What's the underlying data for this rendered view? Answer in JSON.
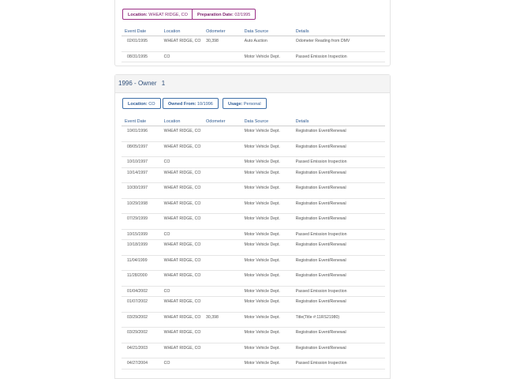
{
  "prev_card": {
    "chips": [
      {
        "label": "Location:",
        "value": "WHEAT RIDGE, CO"
      },
      {
        "label": "Preparation Date:",
        "value": "02/1995"
      }
    ],
    "columns": [
      "Event Date",
      "Location",
      "Odometer",
      "Data Source",
      "Details"
    ],
    "rows": [
      [
        "02/01/1995",
        "WHEAT RIDGE, CO",
        "30,398",
        "Auto Auction",
        "Odometer Reading from DMV"
      ],
      [
        "08/31/1995",
        "CO",
        "",
        "Motor Vehicle Dept.",
        "Passed Emission Inspection"
      ]
    ]
  },
  "owner_card": {
    "year": "1996",
    "dash": "-",
    "owner_label": "Owner",
    "owner_number": "1",
    "chips": [
      {
        "label": "Location:",
        "value": "CO"
      },
      {
        "label": "Owned From:",
        "value": "10/1996"
      },
      {
        "label": "Usage:",
        "value": "Personal"
      }
    ],
    "columns": [
      "Event Date",
      "Location",
      "Odometer",
      "Data Source",
      "Details"
    ],
    "rows": [
      [
        "10/01/1996",
        "WHEAT RIDGE, CO",
        "",
        "Motor Vehicle Dept.",
        "Registration Event/Renewal"
      ],
      [
        "08/05/1997",
        "WHEAT RIDGE, CO",
        "",
        "Motor Vehicle Dept.",
        "Registration Event/Renewal"
      ],
      [
        "10/10/1997",
        "CO",
        "",
        "Motor Vehicle Dept.",
        "Passed Emission Inspection"
      ],
      [
        "10/14/1997",
        "WHEAT RIDGE, CO",
        "",
        "Motor Vehicle Dept.",
        "Registration Event/Renewal"
      ],
      [
        "10/30/1997",
        "WHEAT RIDGE, CO",
        "",
        "Motor Vehicle Dept.",
        "Registration Event/Renewal"
      ],
      [
        "10/29/1998",
        "WHEAT RIDGE, CO",
        "",
        "Motor Vehicle Dept.",
        "Registration Event/Renewal"
      ],
      [
        "07/29/1999",
        "WHEAT RIDGE, CO",
        "",
        "Motor Vehicle Dept.",
        "Registration Event/Renewal"
      ],
      [
        "10/15/1999",
        "CO",
        "",
        "Motor Vehicle Dept.",
        "Passed Emission Inspection"
      ],
      [
        "10/18/1999",
        "WHEAT RIDGE, CO",
        "",
        "Motor Vehicle Dept.",
        "Registration Event/Renewal"
      ],
      [
        "11/04/1999",
        "WHEAT RIDGE, CO",
        "",
        "Motor Vehicle Dept.",
        "Registration Event/Renewal"
      ],
      [
        "11/28/2000",
        "WHEAT RIDGE, CO",
        "",
        "Motor Vehicle Dept.",
        "Registration Event/Renewal"
      ],
      [
        "01/04/2002",
        "CO",
        "",
        "Motor Vehicle Dept.",
        "Passed Emission Inspection"
      ],
      [
        "01/07/2002",
        "WHEAT RIDGE, CO",
        "",
        "Motor Vehicle Dept.",
        "Registration Event/Renewal"
      ],
      [
        "03/29/2002",
        "WHEAT RIDGE, CO",
        "30,398",
        "Motor Vehicle Dept.",
        "Title(Title #:11RS21980)"
      ],
      [
        "03/29/2002",
        "WHEAT RIDGE, CO",
        "",
        "Motor Vehicle Dept.",
        "Registration Event/Renewal"
      ],
      [
        "04/21/2003",
        "WHEAT RIDGE, CO",
        "",
        "Motor Vehicle Dept.",
        "Registration Event/Renewal"
      ],
      [
        "04/27/2004",
        "CO",
        "",
        "Motor Vehicle Dept.",
        "Passed Emission Inspection"
      ]
    ]
  },
  "colors": {
    "chip_purple": "#9b2f86",
    "chip_blue": "#3e6fa8",
    "header_text": "#2f5a90"
  }
}
